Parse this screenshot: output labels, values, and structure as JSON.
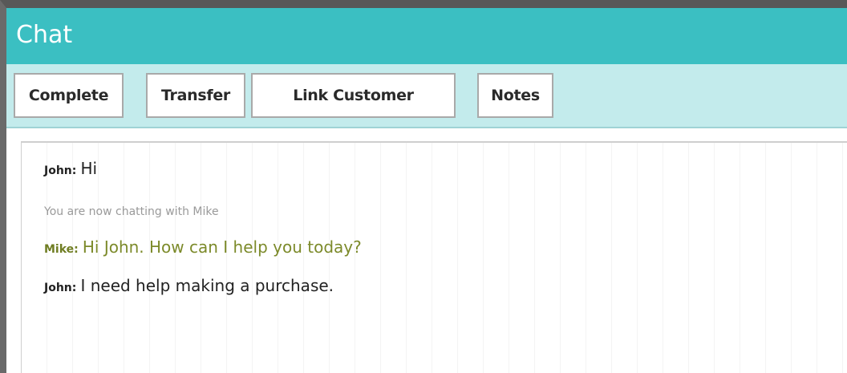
{
  "window": {
    "title": "Chat"
  },
  "toolbar": {
    "complete_label": "Complete",
    "transfer_label": "Transfer",
    "link_customer_label": "Link Customer",
    "notes_label": "Notes"
  },
  "transcript": {
    "messages": [
      {
        "sender": "John:",
        "text": "Hi"
      },
      {
        "system": "You are now chatting with Mike"
      },
      {
        "sender": "Mike:",
        "text": "Hi John. How can I help you today?"
      },
      {
        "sender": "John:",
        "text": "I need help making a purchase."
      }
    ]
  },
  "colors": {
    "titlebar": "#3bbfc2",
    "toolbar": "#c3ebec",
    "agent_text": "#7c8a2a",
    "system_text": "#9a9a9a"
  }
}
